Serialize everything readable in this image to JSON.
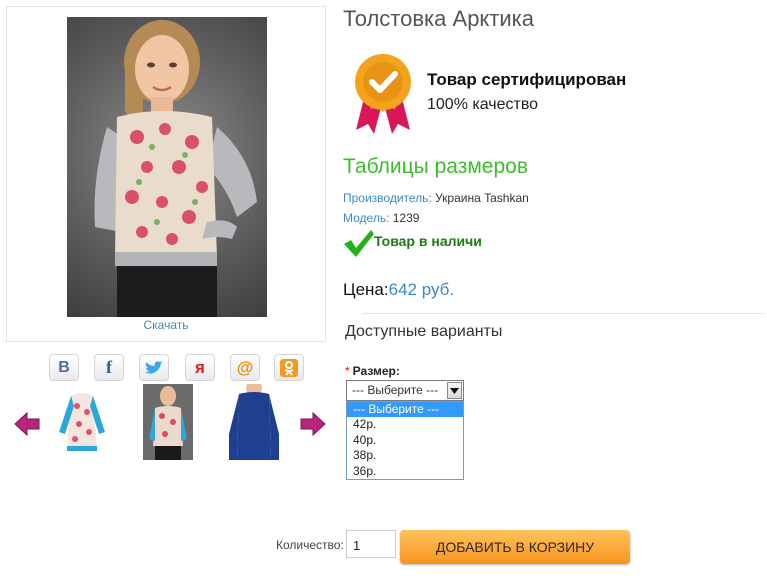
{
  "gallery": {
    "download_label": "Скачать",
    "social": [
      "vk-icon",
      "facebook-icon",
      "twitter-icon",
      "yandex-icon",
      "mailru-icon",
      "odnoklassniki-icon"
    ]
  },
  "product": {
    "title": "Толстовка Арктика",
    "certificate": {
      "title": "Товар сертифицирован",
      "subtitle": "100% качество"
    },
    "size_tables_link": "Таблицы размеров",
    "manufacturer_label": "Производитель:",
    "manufacturer_value": " Украина Tashkan",
    "model_label": "Модель:",
    "model_value": " 1239",
    "stock_status": "Товар в наличи",
    "price_label": "Цена:",
    "price_value": "642 руб."
  },
  "options": {
    "heading": "Доступные варианты",
    "size_label": "Размер:",
    "required_mark": "*",
    "selected": "--- Выберите ---",
    "items": [
      "--- Выберите ---",
      "42р.",
      "40р.",
      "38р.",
      "36р."
    ]
  },
  "purchase": {
    "quantity_label": "Количество:",
    "quantity_value": "1",
    "add_to_cart_label": "ДОБАВИТЬ В КОРЗИНУ"
  },
  "colors": {
    "link_blue": "#3a8ac7",
    "green_heading": "#3ebd2c",
    "cart_orange": "#f7941d",
    "arrow_magenta": "#b8267c"
  }
}
